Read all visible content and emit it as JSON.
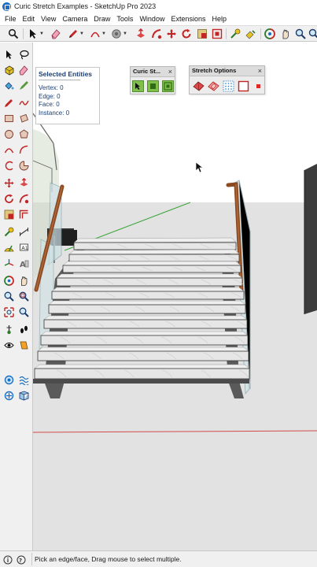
{
  "window": {
    "title": "Curic Stretch Examples - SketchUp Pro 2023"
  },
  "menu": [
    "File",
    "Edit",
    "View",
    "Camera",
    "Draw",
    "Tools",
    "Window",
    "Extensions",
    "Help"
  ],
  "entity_info": {
    "title": "Selected Entities",
    "divider": "-----------------------------",
    "rows": [
      "Vertex: 0",
      "Edge: 0",
      "Face: 0",
      "Instance: 0"
    ]
  },
  "curic_toolbar": {
    "title": "Curic St...",
    "close": "×"
  },
  "stretch_options": {
    "title": "Stretch Options",
    "close": "×"
  },
  "status": {
    "text": "Pick an edge/face, Drag mouse to select multiple."
  },
  "colors": {
    "toolbar_bg": "#f0f0f0",
    "sky": "#ffffff",
    "ground": "#e2e2e2",
    "red_axis": "#d24a4a",
    "green_axis": "#3aa53a",
    "handrail": "#8c4a23",
    "step_frame": "#5a5a5a",
    "glass": "#cfe2e6",
    "panel_title": "#1c3f74"
  },
  "icons": {
    "toolbar": [
      "search-icon",
      "select-arrow-icon",
      "eraser-icon",
      "pencil-line-icon",
      "arc-icon",
      "paint-bucket-icon",
      "move-icon",
      "push-pull-icon",
      "orbit-icon",
      "rotate-icon",
      "offset-icon",
      "follow-me-icon",
      "scale-icon",
      "tape-measure-icon",
      "section-plane-icon",
      "zoom-icon",
      "zoom-extents-icon"
    ],
    "statusbar": [
      "info-icon",
      "geo-location-icon"
    ]
  }
}
